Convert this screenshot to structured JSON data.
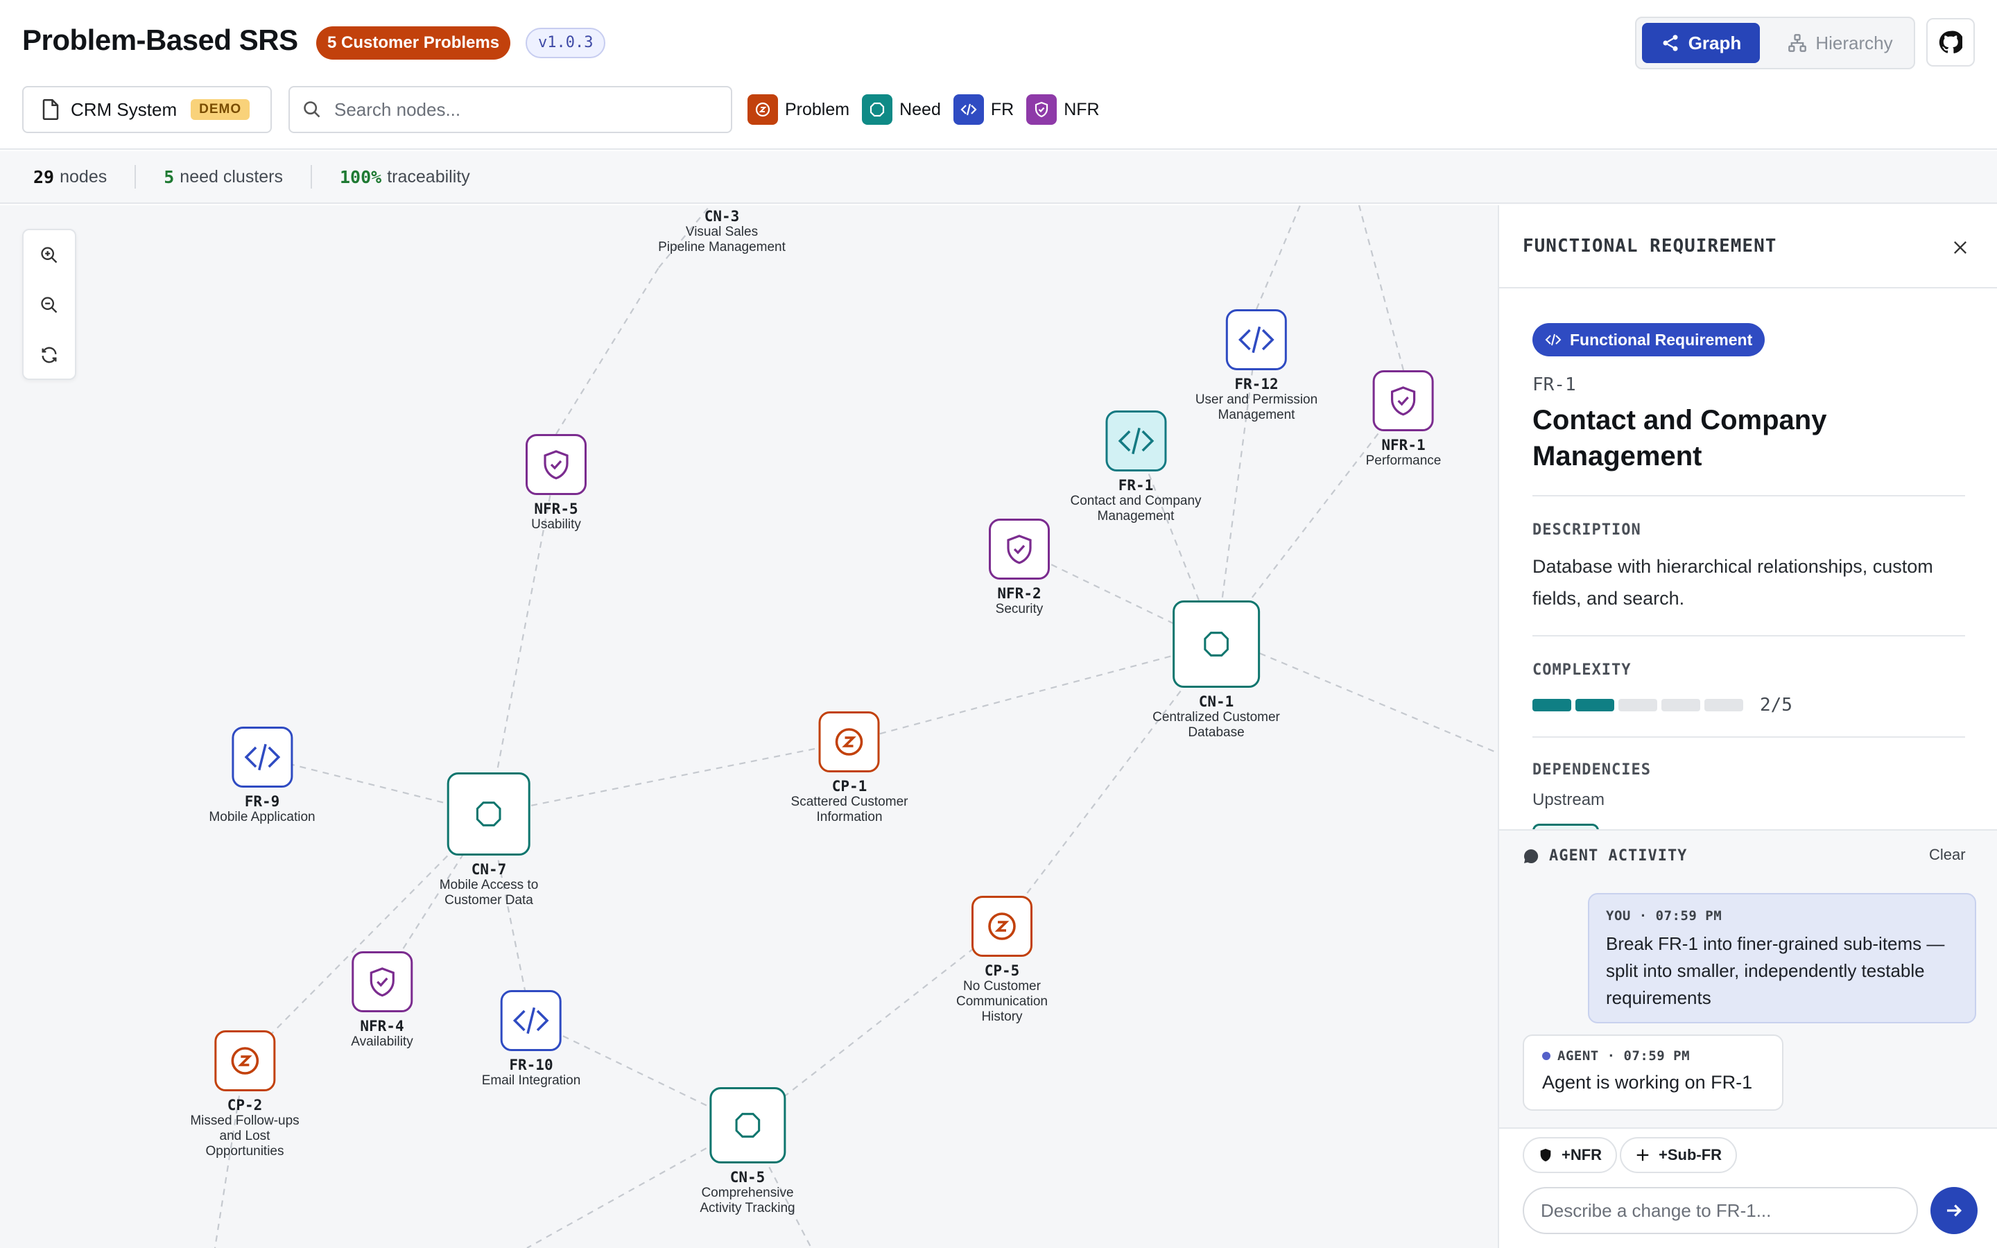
{
  "header": {
    "app_title": "Problem-Based SRS",
    "problems_badge": "5 Customer Problems",
    "version": "v1.0.3",
    "view_tabs": {
      "graph": "Graph",
      "hierarchy": "Hierarchy",
      "active": "Graph"
    },
    "project": {
      "name": "CRM System",
      "badge": "DEMO"
    },
    "search": {
      "placeholder": "Search nodes...",
      "value": ""
    },
    "legend": [
      {
        "label": "Problem",
        "color": "#c2410c"
      },
      {
        "label": "Need",
        "color": "#0f8a86"
      },
      {
        "label": "FR",
        "color": "#2f4bc2"
      },
      {
        "label": "NFR",
        "color": "#8e3aa8"
      }
    ]
  },
  "stats": {
    "nodes_value": "29",
    "nodes_label": "nodes",
    "clusters_value": "5",
    "clusters_label": "need clusters",
    "trace_value": "100%",
    "trace_label": "traceability"
  },
  "graph": {
    "nodes": [
      {
        "id": "CN-3",
        "label": [
          "Visual Sales",
          "Pipeline Management"
        ],
        "type": "need"
      },
      {
        "id": "NFR-5",
        "label": [
          "Usability"
        ],
        "type": "nfr"
      },
      {
        "id": "FR-12",
        "label": [
          "User and Permission",
          "Management"
        ],
        "type": "fr"
      },
      {
        "id": "NFR-1",
        "label": [
          "Performance"
        ],
        "type": "nfr"
      },
      {
        "id": "FR-1",
        "label": [
          "Contact and Company",
          "Management"
        ],
        "type": "fr",
        "selected": true
      },
      {
        "id": "NFR-2",
        "label": [
          "Security"
        ],
        "type": "nfr"
      },
      {
        "id": "CN-1",
        "label": [
          "Centralized Customer",
          "Database"
        ],
        "type": "need"
      },
      {
        "id": "CP-1",
        "label": [
          "Scattered Customer",
          "Information"
        ],
        "type": "problem"
      },
      {
        "id": "FR-9",
        "label": [
          "Mobile Application"
        ],
        "type": "fr"
      },
      {
        "id": "CN-7",
        "label": [
          "Mobile Access to",
          "Customer Data"
        ],
        "type": "need"
      },
      {
        "id": "CP-5",
        "label": [
          "No Customer",
          "Communication",
          "History"
        ],
        "type": "problem"
      },
      {
        "id": "NFR-4",
        "label": [
          "Availability"
        ],
        "type": "nfr"
      },
      {
        "id": "FR-10",
        "label": [
          "Email Integration"
        ],
        "type": "fr"
      },
      {
        "id": "CP-2",
        "label": [
          "Missed Follow-ups",
          "and Lost",
          "Opportunities"
        ],
        "type": "problem"
      },
      {
        "id": "CN-5",
        "label": [
          "Comprehensive",
          "Activity Tracking"
        ],
        "type": "need"
      }
    ]
  },
  "detail": {
    "panel_title": "FUNCTIONAL REQUIREMENT",
    "type_badge": "Functional Requirement",
    "id": "FR-1",
    "title": "Contact and Company Management",
    "description_label": "DESCRIPTION",
    "description": "Database with hierarchical relationships, custom fields, and search.",
    "complexity_label": "COMPLEXITY",
    "complexity": {
      "value": 2,
      "max": 5,
      "text": "2/5"
    },
    "dependencies_label": "DEPENDENCIES",
    "upstream_label": "Upstream"
  },
  "agent": {
    "title": "AGENT ACTIVITY",
    "clear_label": "Clear",
    "messages": [
      {
        "meta": "YOU · 07:59 PM",
        "text": "Break FR-1 into finer-grained sub-items — split into smaller, independently testable requirements"
      },
      {
        "meta": "AGENT · 07:59 PM",
        "text": "Agent is working on FR-1"
      }
    ],
    "chips": {
      "nfr": "+NFR",
      "subfr": "+Sub-FR"
    },
    "input_placeholder": "Describe a change to FR-1..."
  }
}
